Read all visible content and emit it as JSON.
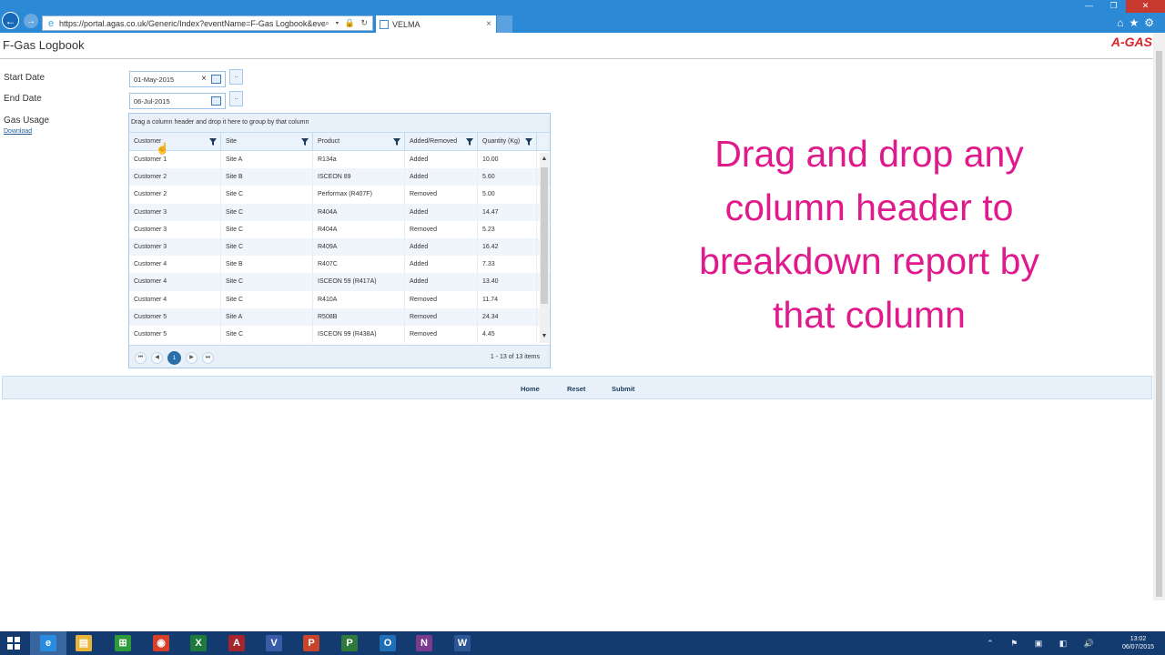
{
  "browser": {
    "url": "https://portal.agas.co.uk/Generic/Index?eventName=F-Gas Logbook&eventid=399",
    "url_tools": "⌕ ▾ 🔒 ↻",
    "tab_title": "VELMA",
    "tab_close": "×",
    "back_glyph": "←",
    "fwd_glyph": "→",
    "window_buttons": [
      "—",
      "❐",
      "✕"
    ],
    "toolbar_icons": "⌂★⚙"
  },
  "page": {
    "title": "F-Gas Logbook",
    "logo": "A-GAS"
  },
  "form": {
    "start_label": "Start Date",
    "start_value": "01-May-2015",
    "start_clear": "×",
    "end_label": "End Date",
    "end_value": "06-Jul-2015",
    "dots_label": "..",
    "gas_usage_label": "Gas Usage",
    "download_label": "Download"
  },
  "grid": {
    "group_hint": "Drag a column header and drop it here to group by that column",
    "columns": [
      "Customer",
      "Site",
      "Product",
      "Added/Removed",
      "Quantity (Kg)"
    ],
    "rows": [
      [
        "Customer 1",
        "Site A",
        "R134a",
        "Added",
        "10.00"
      ],
      [
        "Customer 2",
        "Site B",
        "ISCEON 89",
        "Added",
        "5.60"
      ],
      [
        "Customer 2",
        "Site C",
        "Performax (R407F)",
        "Removed",
        "5.00"
      ],
      [
        "Customer 3",
        "Site C",
        "R404A",
        "Added",
        "14.47"
      ],
      [
        "Customer 3",
        "Site C",
        "R404A",
        "Removed",
        "5.23"
      ],
      [
        "Customer 3",
        "Site C",
        "R409A",
        "Added",
        "16.42"
      ],
      [
        "Customer 4",
        "Site B",
        "R407C",
        "Added",
        "7.33"
      ],
      [
        "Customer 4",
        "Site C",
        "ISCEON 59 (R417A)",
        "Added",
        "13.40"
      ],
      [
        "Customer 4",
        "Site C",
        "R410A",
        "Removed",
        "11.74"
      ],
      [
        "Customer 5",
        "Site A",
        "R508B",
        "Removed",
        "24.34"
      ],
      [
        "Customer 5",
        "Site C",
        "ISCEON 99 (R438A)",
        "Removed",
        "4.45"
      ]
    ],
    "scroll_up": "▲",
    "scroll_down": "▼",
    "pager": {
      "first": "⏮",
      "prev": "◀",
      "current": "1",
      "next": "▶",
      "last": "⏭",
      "info": "1 - 13 of 13 items"
    }
  },
  "footer": {
    "home": "Home",
    "reset": "Reset",
    "submit": "Submit"
  },
  "overlay": {
    "line1": "Drag and drop any",
    "line2": "column header to",
    "line3": "breakdown report by",
    "line4": "that column"
  },
  "taskbar": {
    "apps": [
      {
        "name": "ie",
        "glyph": "e",
        "color": "#2a8ce0"
      },
      {
        "name": "explorer",
        "glyph": "▤",
        "color": "#e8b53a"
      },
      {
        "name": "store",
        "glyph": "⊞",
        "color": "#2e9a3a"
      },
      {
        "name": "chrome",
        "glyph": "◉",
        "color": "#d9402a"
      },
      {
        "name": "excel",
        "glyph": "X",
        "color": "#1d7a3c"
      },
      {
        "name": "access",
        "glyph": "A",
        "color": "#a4262c"
      },
      {
        "name": "visio",
        "glyph": "V",
        "color": "#3a5ba8"
      },
      {
        "name": "powerpoint",
        "glyph": "P",
        "color": "#c8452b"
      },
      {
        "name": "project",
        "glyph": "P",
        "color": "#2f7a3a"
      },
      {
        "name": "outlook",
        "glyph": "O",
        "color": "#1e6fb8"
      },
      {
        "name": "onenote",
        "glyph": "N",
        "color": "#7a3b8f"
      },
      {
        "name": "word",
        "glyph": "W",
        "color": "#2b5797"
      }
    ],
    "tray": "⌃ ⚑ ▣ ◧ 🔊",
    "time": "13:02",
    "date": "06/07/2015"
  },
  "colors": {
    "chrome": "#2b89d6",
    "overlay_text": "#e0198c",
    "logo": "#d9242c",
    "taskbar": "#133b70"
  }
}
